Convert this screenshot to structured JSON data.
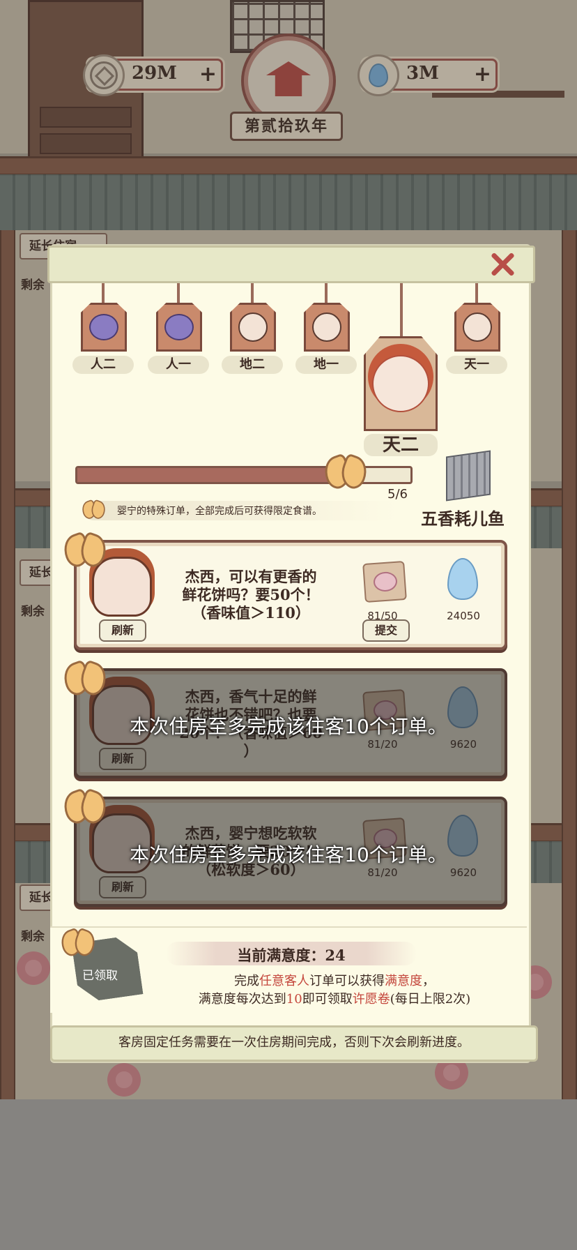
{
  "hud": {
    "coins": "29M",
    "coins_plus": "+",
    "drops": "3M",
    "drops_plus": "+",
    "year": "第贰拾玖年"
  },
  "background": {
    "side_tags": [
      "延长住宿",
      "延长",
      "延长"
    ],
    "side_remain": [
      "剩余",
      "剩余",
      "剩余"
    ]
  },
  "tiers": [
    {
      "label": "人二",
      "icon": "fruit-icon"
    },
    {
      "label": "人一",
      "icon": "fruit-icon"
    },
    {
      "label": "地二",
      "icon": "guest-face-icon"
    },
    {
      "label": "地一",
      "icon": "guest-face-icon"
    },
    {
      "label": "天二",
      "icon": "guest-face-icon",
      "selected": true
    },
    {
      "label": "天一",
      "icon": "guest-face-icon"
    }
  ],
  "progress": {
    "text": "5/6",
    "value": 0.833
  },
  "note": "婴宁的特殊订单，全部完成后可获得限定食谱。",
  "recipe": "五香耗儿鱼",
  "orders": [
    {
      "request": [
        "杰西，可以有更香的",
        "鲜花饼吗？要50个！",
        "（香味值＞110）"
      ],
      "refresh": "刷新",
      "item_count": "81/50",
      "submit": "提交",
      "reward": "24050",
      "locked": false
    },
    {
      "request": [
        "杰西，香气十足的鲜",
        "花饼也不错吧？也要",
        "20个！（香味值＞60",
        "）"
      ],
      "refresh": "刷新",
      "item_count": "81/20",
      "reward": "9620",
      "locked": true
    },
    {
      "request": [
        "杰西，婴宁想吃软软",
        "的鲜花饼，要20个！",
        "（松软度＞60）"
      ],
      "refresh": "刷新",
      "item_count": "81/20",
      "reward": "9620",
      "locked": true
    }
  ],
  "lock_message": "本次住房至多完成该住客10个订单。",
  "satisfaction": {
    "title": "当前满意度：24",
    "line1_a": "完成",
    "line1_hl1": "任意客人",
    "line1_b": "订单可以获得",
    "line1_hl2": "满意度",
    "line1_c": "，",
    "line2_a": "满意度每次达到",
    "line2_hl1": "10",
    "line2_b": "即可领取",
    "line2_hl2": "许愿卷",
    "line2_c": "(每日上限2次)",
    "claimed": "已领取"
  },
  "footer": "客房固定任务需要在一次住房期间完成，否则下次会刷新进度。",
  "colors": {
    "accent": "#b84e48",
    "highlight": "#c4463c",
    "card_border": "#7e5548"
  }
}
